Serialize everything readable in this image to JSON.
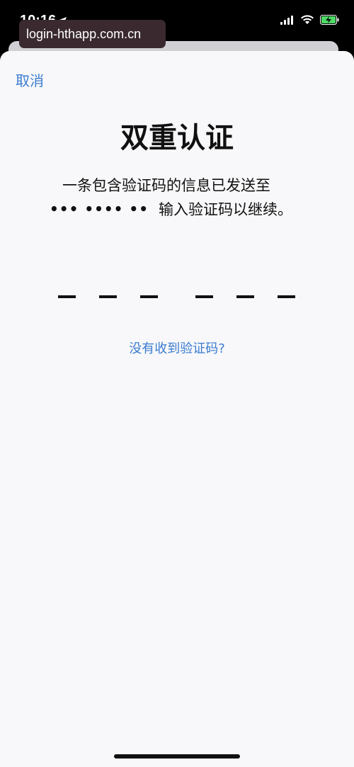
{
  "status_bar": {
    "time": "10:16",
    "location_icon": "location-arrow-icon",
    "signal_icon": "cellular-signal-icon",
    "wifi_icon": "wifi-icon",
    "battery_icon": "battery-charging-icon",
    "battery_color": "#4cd964"
  },
  "url_bar": {
    "url": "login-hthapp.com.cn"
  },
  "sheet": {
    "cancel_label": "取消",
    "title": "双重认证",
    "message_line1": "一条包含验证码的信息已发送至",
    "masked_number": "••• •••• ••",
    "message_line2_suffix": "输入验证码以继续。",
    "code_length": 6,
    "resend_label": "没有收到验证码?"
  },
  "colors": {
    "link": "#3a7bd0",
    "sheet_bg": "#f8f8fa",
    "text": "#111111"
  }
}
